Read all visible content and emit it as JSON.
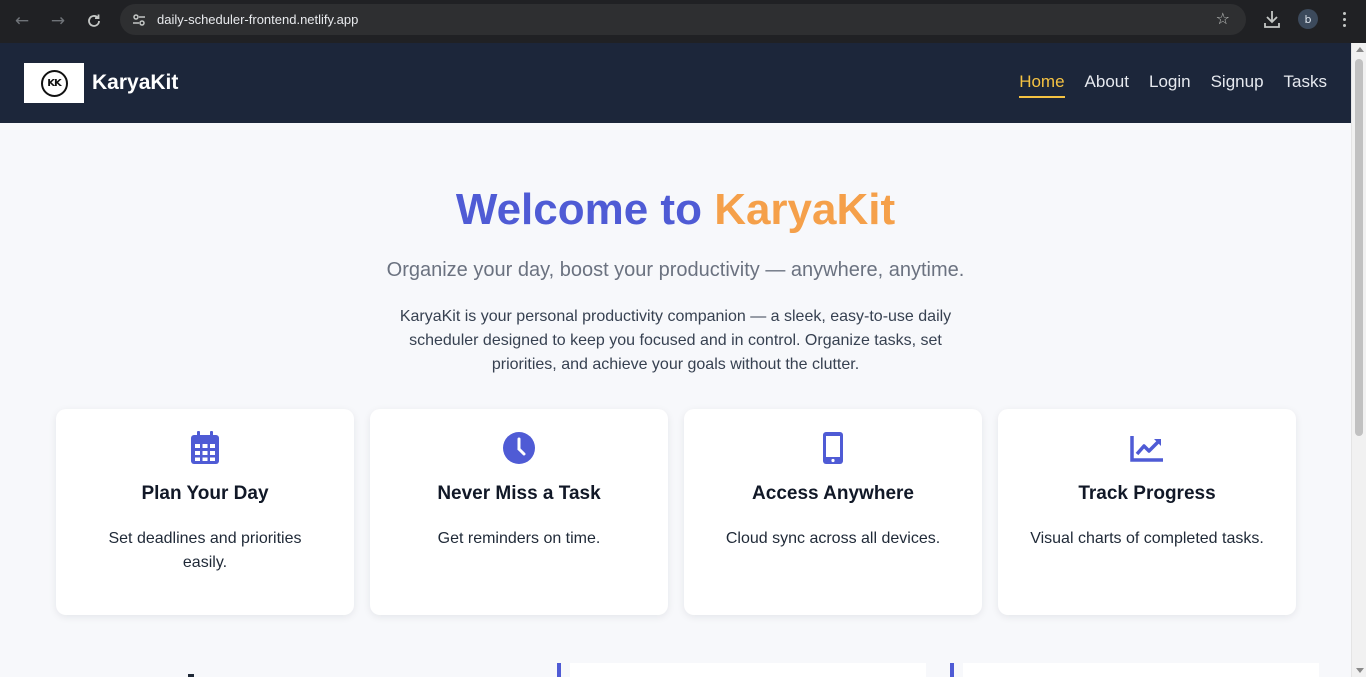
{
  "browser": {
    "url": "daily-scheduler-frontend.netlify.app",
    "profile_initial": "b"
  },
  "header": {
    "logo_text": "KK",
    "brand": "KaryaKit",
    "nav": [
      {
        "label": "Home",
        "active": true
      },
      {
        "label": "About",
        "active": false
      },
      {
        "label": "Login",
        "active": false
      },
      {
        "label": "Signup",
        "active": false
      },
      {
        "label": "Tasks",
        "active": false
      }
    ]
  },
  "hero": {
    "title_prefix": "Welcome to",
    "title_brand": "KaryaKit",
    "subtitle": "Organize your day, boost your productivity — anywhere, anytime.",
    "description": "KaryaKit is your personal productivity companion — a sleek, easy-to-use daily scheduler designed to keep you focused and in control. Organize tasks, set priorities, and achieve your goals without the clutter."
  },
  "features": [
    {
      "icon": "calendar-icon",
      "title": "Plan Your Day",
      "text": "Set deadlines and priorities easily."
    },
    {
      "icon": "clock-icon",
      "title": "Never Miss a Task",
      "text": "Get reminders on time."
    },
    {
      "icon": "mobile-icon",
      "title": "Access Anywhere",
      "text": "Cloud sync across all devices."
    },
    {
      "icon": "chart-line-icon",
      "title": "Track Progress",
      "text": "Visual charts of completed tasks."
    }
  ],
  "colors": {
    "header_bg": "#1c263a",
    "primary": "#4f5bd5",
    "accent": "#f5a04a",
    "nav_active": "#f5c242"
  }
}
